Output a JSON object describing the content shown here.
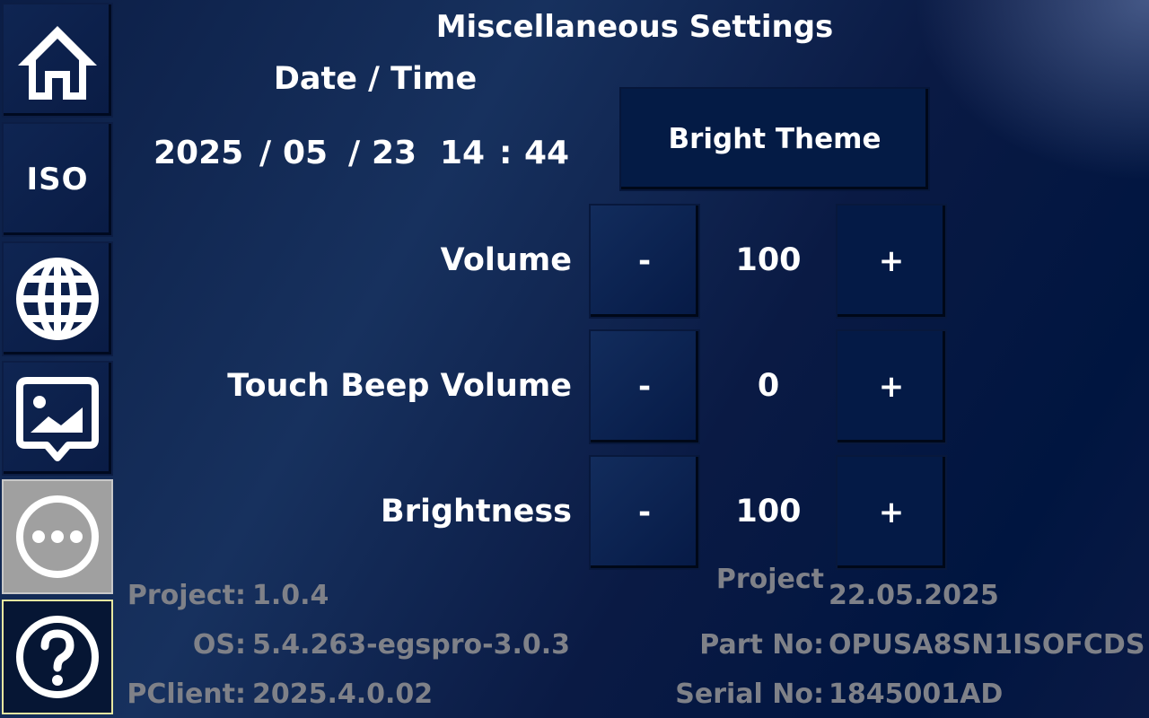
{
  "sidebar": {
    "items": [
      {
        "icon": "home-icon"
      },
      {
        "label": "ISO"
      },
      {
        "icon": "globe-icon"
      },
      {
        "icon": "image-message-icon"
      },
      {
        "icon": "more-icon",
        "active": true
      },
      {
        "icon": "help-icon"
      }
    ]
  },
  "page": {
    "title": "Miscellaneous Settings"
  },
  "datetime": {
    "label": "Date / Time",
    "year": "2025",
    "sep1": "/",
    "month": "05",
    "sep2": "/",
    "day": "23",
    "hour": "14",
    "colon": ":",
    "minute": "44"
  },
  "theme_button": {
    "label": "Bright Theme"
  },
  "controls": [
    {
      "label": "Volume",
      "value": "100",
      "minus": "-",
      "plus": "+"
    },
    {
      "label": "Touch Beep Volume",
      "value": "0",
      "minus": "-",
      "plus": "+"
    },
    {
      "label": "Brightness",
      "value": "100",
      "minus": "-",
      "plus": "+"
    }
  ],
  "info": {
    "project_label": "Project:",
    "project_value": "1.0.4",
    "os_label": "OS:",
    "os_value": "5.4.263-egspro-3.0.3",
    "pclient_label": "PClient:",
    "pclient_value": "2025.4.0.02",
    "project_date_label": "Project",
    "project_date_value": "22.05.2025",
    "partno_label": "Part No:",
    "partno_value": "OPUSA8SN1ISOFCDS",
    "serial_label": "Serial No:",
    "serial_value": "1845001AD"
  },
  "colors": {
    "info_text": "#7f8188",
    "active_tab": "#a0a0a0",
    "button_bg": "#041b45"
  }
}
